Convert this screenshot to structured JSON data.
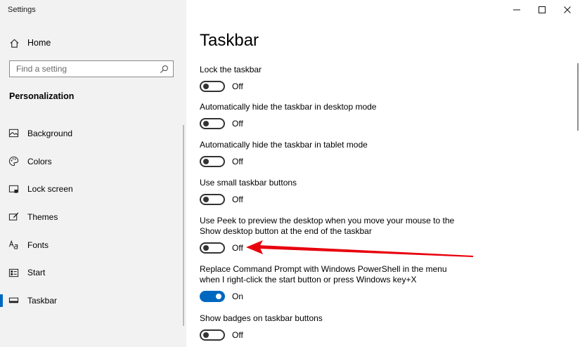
{
  "app": {
    "title": "Settings"
  },
  "sidebar": {
    "home_label": "Home",
    "search_placeholder": "Find a setting",
    "section_heading": "Personalization",
    "items": [
      {
        "label": "Background",
        "icon": "picture-icon"
      },
      {
        "label": "Colors",
        "icon": "palette-icon"
      },
      {
        "label": "Lock screen",
        "icon": "lock-screen-icon"
      },
      {
        "label": "Themes",
        "icon": "brush-icon"
      },
      {
        "label": "Fonts",
        "icon": "fonts-icon"
      },
      {
        "label": "Start",
        "icon": "start-icon"
      },
      {
        "label": "Taskbar",
        "icon": "taskbar-icon",
        "active": true
      }
    ]
  },
  "main": {
    "title": "Taskbar",
    "settings": [
      {
        "label": "Lock the taskbar",
        "state": "Off"
      },
      {
        "label": "Automatically hide the taskbar in desktop mode",
        "state": "Off"
      },
      {
        "label": "Automatically hide the taskbar in tablet mode",
        "state": "Off"
      },
      {
        "label": "Use small taskbar buttons",
        "state": "Off"
      },
      {
        "label_line1": "Use Peek to preview the desktop when you move your mouse to the",
        "label_line2": "Show desktop button at the end of the taskbar",
        "state": "Off"
      },
      {
        "label_line1": "Replace Command Prompt with Windows PowerShell in the menu",
        "label_line2": "when I right-click the start button or press Windows key+X",
        "state": "On"
      },
      {
        "label": "Show badges on taskbar buttons",
        "state": "Off"
      }
    ]
  },
  "colors": {
    "accent": "#0067c0",
    "sidebar_bg": "#f2f2f2",
    "annotation_arrow": "#e8000d"
  }
}
